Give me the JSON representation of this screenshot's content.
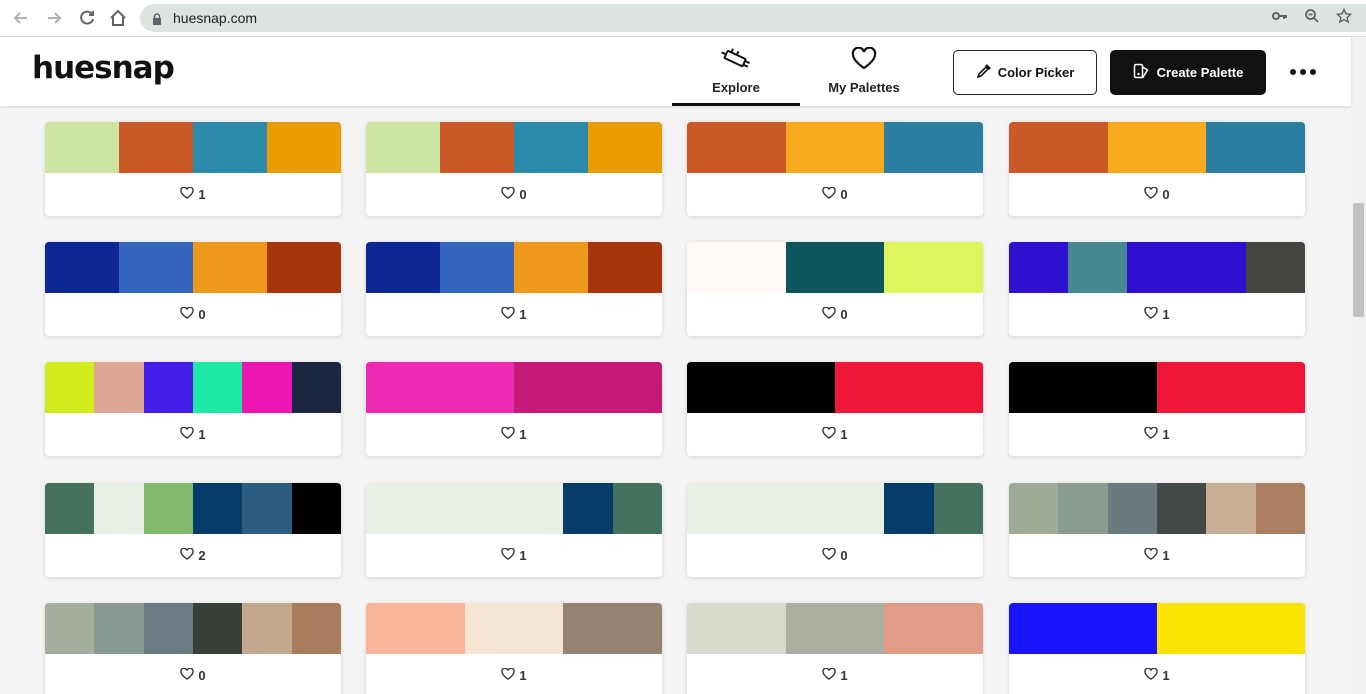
{
  "browser": {
    "url": "huesnap.com",
    "icons": [
      "back-arrow-icon",
      "forward-arrow-icon",
      "reload-icon",
      "home-icon",
      "lock-icon",
      "key-icon",
      "zoom-icon",
      "star-icon"
    ]
  },
  "header": {
    "logo": "huesnap",
    "nav": [
      {
        "label": "Explore",
        "icon": "dropper-icon",
        "active": true
      },
      {
        "label": "My Palettes",
        "icon": "heart-icon",
        "active": false
      }
    ],
    "color_picker_label": "Color Picker",
    "create_palette_label": "Create Palette"
  },
  "palettes": [
    {
      "colors": [
        "#cce5a3",
        "#c95a28",
        "#2e8aab",
        "#e99b00"
      ],
      "likes": "1"
    },
    {
      "colors": [
        "#cce5a3",
        "#c95a28",
        "#2e8aab",
        "#e99b00"
      ],
      "likes": "0"
    },
    {
      "colors": [
        "#c95a28",
        "#f6aa1c",
        "#2c7ea1"
      ],
      "likes": "0"
    },
    {
      "colors": [
        "#c95a28",
        "#f6aa1c",
        "#2c7ea1"
      ],
      "likes": "0"
    },
    {
      "colors": [
        "#0d2894",
        "#3566bd",
        "#ef991c",
        "#a7350b"
      ],
      "likes": "0"
    },
    {
      "colors": [
        "#0d2894",
        "#3566bd",
        "#ef991c",
        "#a7350b"
      ],
      "likes": "1"
    },
    {
      "colors": [
        "#fffaf8",
        "#0e565c",
        "#dcf65d"
      ],
      "likes": "0"
    },
    {
      "colors": [
        "#3010d0",
        "#478892",
        "#3010d0",
        "#3010d0",
        "#444441"
      ],
      "likes": "1"
    },
    {
      "colors": [
        "#d1eb1c",
        "#dfa896",
        "#431de8",
        "#1fe9a6",
        "#ec17b2",
        "#1b2643"
      ],
      "likes": "1"
    },
    {
      "colors": [
        "#ed2ab4",
        "#c51a77"
      ],
      "likes": "1"
    },
    {
      "colors": [
        "#000000",
        "#f01637"
      ],
      "likes": "1"
    },
    {
      "colors": [
        "#000000",
        "#f01637"
      ],
      "likes": "1"
    },
    {
      "colors": [
        "#44725e",
        "#e8f0e5",
        "#80b96c",
        "#053c6a",
        "#2c5c80",
        "#000000"
      ],
      "likes": "2"
    },
    {
      "colors": [
        "#e8efe4",
        "#e8efe4",
        "#e8efe4",
        "#e8efe4",
        "#053c6a",
        "#44725e"
      ],
      "likes": "1"
    },
    {
      "colors": [
        "#e8efe4",
        "#e8efe4",
        "#e8efe4",
        "#e8efe4",
        "#053c6a",
        "#44725e"
      ],
      "likes": "0"
    },
    {
      "colors": [
        "#9fab97",
        "#889c92",
        "#6a7b80",
        "#434948",
        "#c8ae95",
        "#aa7e61"
      ],
      "likes": "1"
    },
    {
      "colors": [
        "#a5ad9d",
        "#889a91",
        "#6a7c81",
        "#383e38",
        "#c4a88d",
        "#aa7c5e"
      ],
      "likes": "0"
    },
    {
      "colors": [
        "#f7b699",
        "#f5e6d4",
        "#958270"
      ],
      "likes": "1"
    },
    {
      "colors": [
        "#d9d9ce",
        "#adada2",
        "#e19c85"
      ],
      "likes": "1"
    },
    {
      "colors": [
        "#1a14fb",
        "#f9e303"
      ],
      "likes": "1"
    }
  ]
}
